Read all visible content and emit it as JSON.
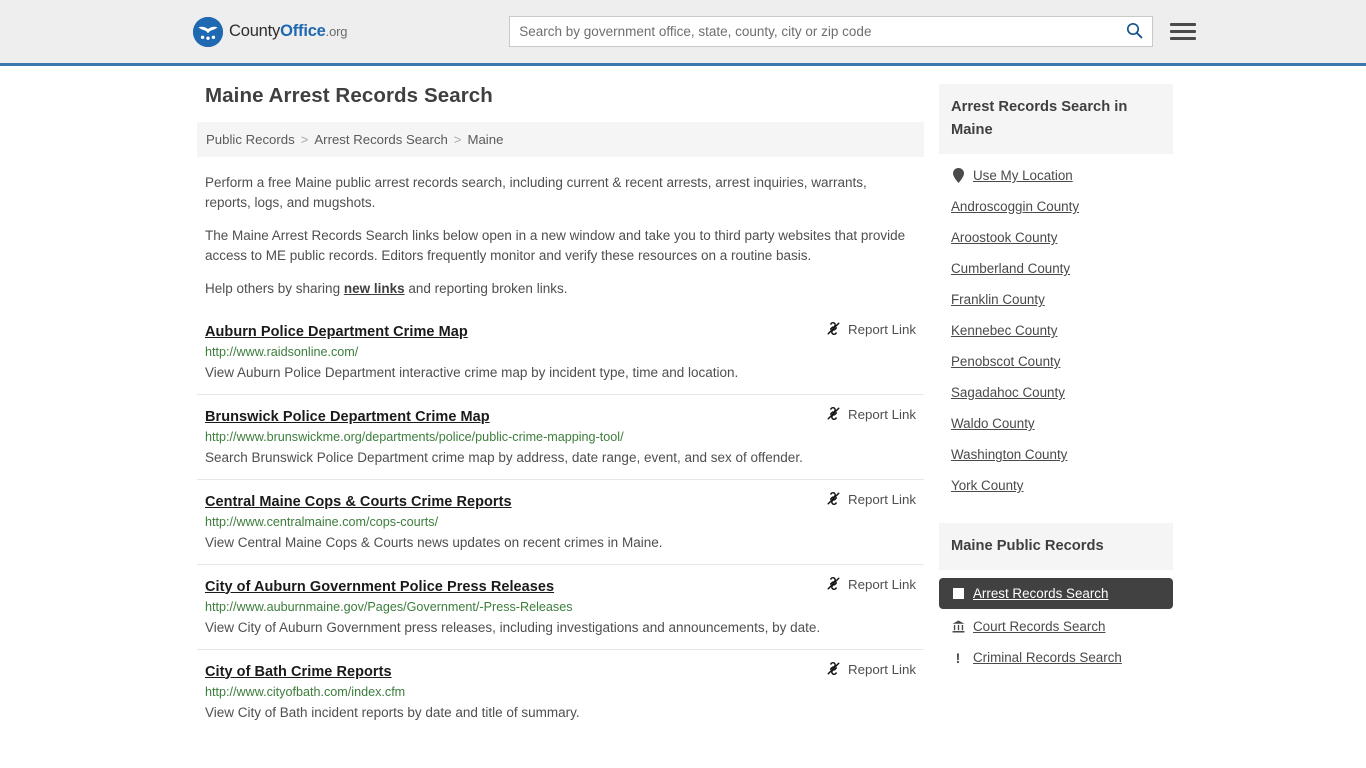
{
  "header": {
    "logo": {
      "part1": "County",
      "part2": "Office",
      "part3": ".org",
      "icon": "eagle-seal-logo"
    },
    "search": {
      "placeholder": "Search by government office, state, county, city or zip code",
      "value": "",
      "search_icon": "search-icon"
    },
    "menu_icon": "hamburger-menu-icon",
    "accent_color": "#3b78ad"
  },
  "page_title": "Maine Arrest Records Search",
  "breadcrumb": {
    "items": [
      "Public Records",
      "Arrest Records Search",
      "Maine"
    ],
    "separator": ">"
  },
  "intro": {
    "p1": "Perform a free Maine public arrest records search, including current & recent arrests, arrest inquiries, warrants, reports, logs, and mugshots.",
    "p2": "The Maine Arrest Records Search links below open in a new window and take you to third party websites that provide access to ME public records. Editors frequently monitor and verify these resources on a routine basis.",
    "p3_before": "Help others by sharing ",
    "p3_link": "new links",
    "p3_after": " and reporting broken links."
  },
  "report_link_label": "Report Link",
  "report_link_icon": "broken-link-icon",
  "links": [
    {
      "title": "Auburn Police Department Crime Map",
      "url": "http://www.raidsonline.com/",
      "description": "View Auburn Police Department interactive crime map by incident type, time and location."
    },
    {
      "title": "Brunswick Police Department Crime Map",
      "url": "http://www.brunswickme.org/departments/police/public-crime-mapping-tool/",
      "description": "Search Brunswick Police Department crime map by address, date range, event, and sex of offender."
    },
    {
      "title": "Central Maine Cops & Courts Crime Reports",
      "url": "http://www.centralmaine.com/cops-courts/",
      "description": "View Central Maine Cops & Courts news updates on recent crimes in Maine."
    },
    {
      "title": "City of Auburn Government Police Press Releases",
      "url": "http://www.auburnmaine.gov/Pages/Government/-Press-Releases",
      "description": "View City of Auburn Government press releases, including investigations and announcements, by date."
    },
    {
      "title": "City of Bath Crime Reports",
      "url": "http://www.cityofbath.com/index.cfm",
      "description": "View City of Bath incident reports by date and title of summary."
    }
  ],
  "sidebar": {
    "counties_box": {
      "title": "Arrest Records Search in Maine",
      "items": [
        {
          "label": "Use My Location",
          "icon": "map-pin-icon"
        },
        {
          "label": "Androscoggin County",
          "icon": ""
        },
        {
          "label": "Aroostook County",
          "icon": ""
        },
        {
          "label": "Cumberland County",
          "icon": ""
        },
        {
          "label": "Franklin County",
          "icon": ""
        },
        {
          "label": "Kennebec County",
          "icon": ""
        },
        {
          "label": "Penobscot County",
          "icon": ""
        },
        {
          "label": "Sagadahoc County",
          "icon": ""
        },
        {
          "label": "Waldo County",
          "icon": ""
        },
        {
          "label": "Washington County",
          "icon": ""
        },
        {
          "label": "York County",
          "icon": ""
        }
      ]
    },
    "records_box": {
      "title": "Maine Public Records",
      "items": [
        {
          "label": "Arrest Records Search",
          "icon": "square-icon",
          "active": true
        },
        {
          "label": "Court Records Search",
          "icon": "courthouse-icon",
          "active": false
        },
        {
          "label": "Criminal Records Search",
          "icon": "exclamation-icon",
          "active": false
        }
      ]
    },
    "active_background": "#414141"
  }
}
